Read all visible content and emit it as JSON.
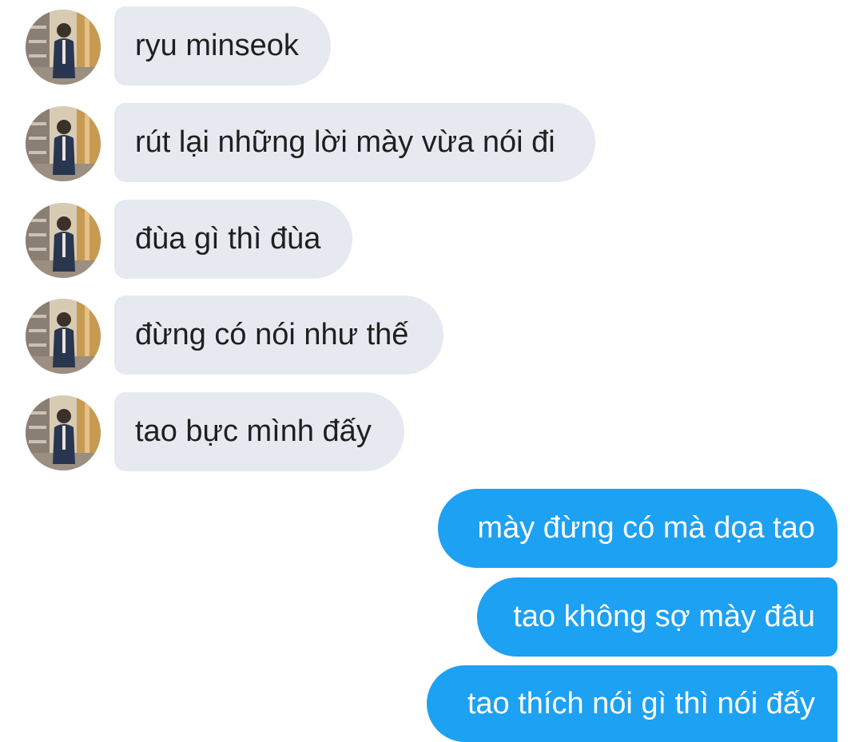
{
  "conversation": {
    "incoming": [
      {
        "text": "ryu minseok"
      },
      {
        "text": "rút lại những lời mày vừa nói đi"
      },
      {
        "text": "đùa gì thì đùa"
      },
      {
        "text": "đừng có nói như thế"
      },
      {
        "text": "tao bực mình đấy"
      }
    ],
    "outgoing": [
      {
        "text": "mày đừng có mà dọa tao"
      },
      {
        "text": "tao không sợ mày đâu"
      },
      {
        "text": "tao thích nói gì thì nói đấy"
      }
    ]
  },
  "colors": {
    "incoming_bubble": "#e6eaf0",
    "outgoing_bubble": "#1da1f2",
    "incoming_text": "#1f1f1f",
    "outgoing_text": "#ffffff"
  },
  "icons": {
    "avatar": "avatar-photo-icon"
  }
}
